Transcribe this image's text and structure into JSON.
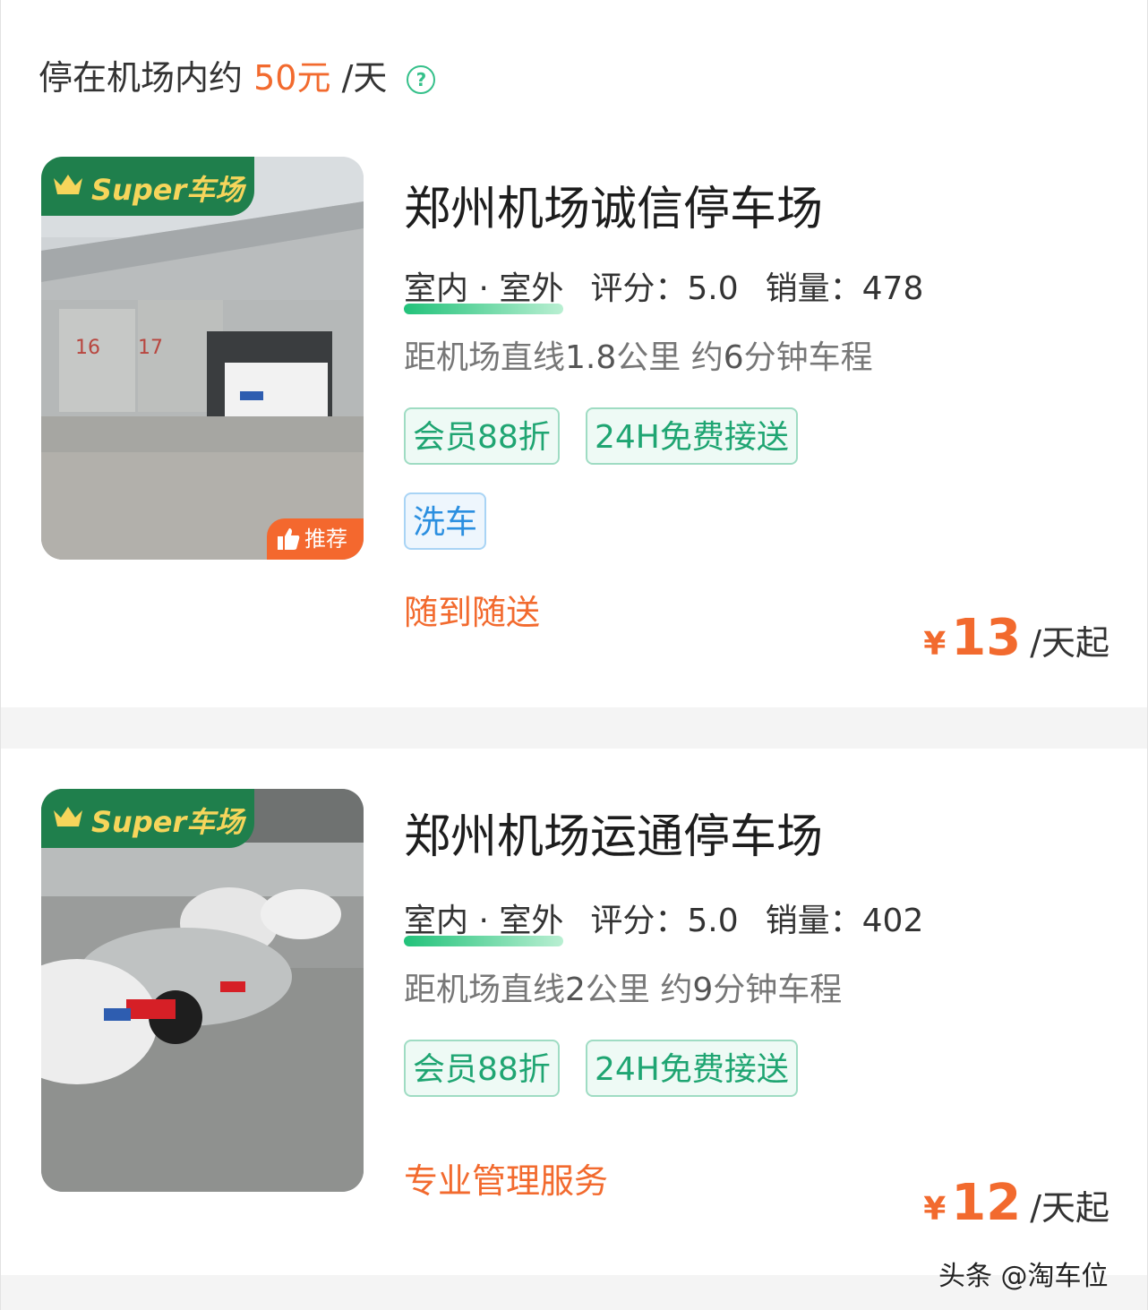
{
  "summary": {
    "prefix": "停在机场内约",
    "price": "50元",
    "unit": "/天",
    "help_icon": "question-circle-icon"
  },
  "colors": {
    "accent": "#f26a2e",
    "green": "#1fa572",
    "brand_green": "#1f7f4c"
  },
  "lots": [
    {
      "badge": "Super车场",
      "recommend": "推荐",
      "name": "郑州机场诚信停车场",
      "type": "室内 · 室外",
      "rating_label": "评分：",
      "rating": "5.0",
      "sales_label": "销量：",
      "sales": "478",
      "distance_prefix": "距机场直线",
      "distance_km": "1.8",
      "distance_mid": "公里 约",
      "distance_min": "6",
      "distance_suffix": "分钟车程",
      "tags": [
        "会员88折",
        "24H免费接送"
      ],
      "extra_tag": "洗车",
      "highlight": "随到随送",
      "yen": "¥",
      "price": "13",
      "price_unit": "/天起"
    },
    {
      "badge": "Super车场",
      "name": "郑州机场运通停车场",
      "type": "室内 · 室外",
      "rating_label": "评分：",
      "rating": "5.0",
      "sales_label": "销量：",
      "sales": "402",
      "distance_prefix": "距机场直线",
      "distance_km": "2",
      "distance_mid": "公里 约",
      "distance_min": "9",
      "distance_suffix": "分钟车程",
      "tags": [
        "会员88折",
        "24H免费接送"
      ],
      "highlight": "专业管理服务",
      "yen": "¥",
      "price": "12",
      "price_unit": "/天起"
    }
  ],
  "watermark": "头条 @淘车位"
}
